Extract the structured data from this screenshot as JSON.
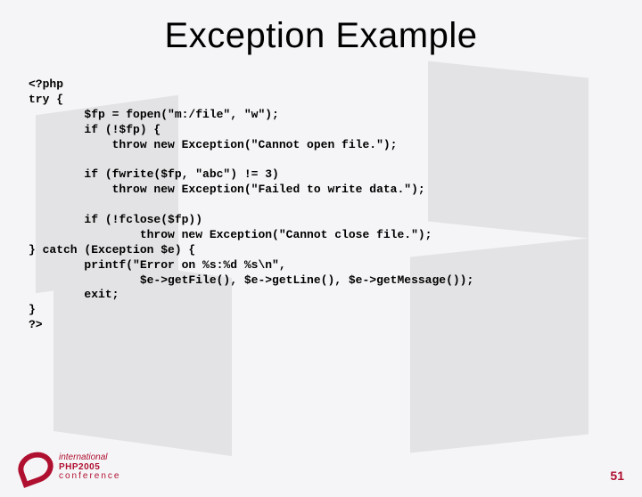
{
  "slide": {
    "title": "Exception Example",
    "code": "<?php\ntry {\n        $fp = fopen(\"m:/file\", \"w\");\n        if (!$fp) {\n            throw new Exception(\"Cannot open file.\");\n\n        if (fwrite($fp, \"abc\") != 3)\n            throw new Exception(\"Failed to write data.\");\n\n        if (!fclose($fp))\n                throw new Exception(\"Cannot close file.\");\n} catch (Exception $e) {\n        printf(\"Error on %s:%d %s\\n\",\n                $e->getFile(), $e->getLine(), $e->getMessage());\n        exit;\n}\n?>"
  },
  "footer": {
    "logo": {
      "line1": "international",
      "line2": "PHP2005",
      "line3": "conference"
    },
    "page_number": "51"
  }
}
